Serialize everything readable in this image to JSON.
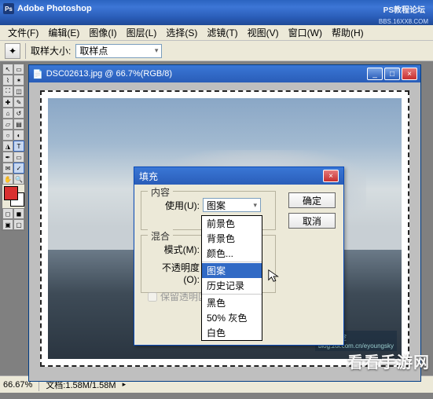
{
  "app": {
    "title": "Adobe Photoshop",
    "tagline1": "PS教程论坛",
    "tagline2": "BBS.16XX8.COM"
  },
  "menu": {
    "items": [
      "文件(F)",
      "编辑(E)",
      "图像(I)",
      "图层(L)",
      "选择(S)",
      "滤镜(T)",
      "视图(V)",
      "窗口(W)",
      "帮助(H)"
    ]
  },
  "options": {
    "sample_label": "取样大小:",
    "sample_value": "取样点"
  },
  "document": {
    "title": "DSC02613.jpg @ 66.7%(RGB/8)",
    "watermark_line1": "样的天空",
    "watermark_line2": "blog.zol.com.cn/eyoungsky"
  },
  "dialog": {
    "title": "填充",
    "content_legend": "内容",
    "use_label": "使用(U):",
    "use_value": "图案",
    "blend_legend": "混合",
    "mode_label": "模式(M):",
    "mode_value": "",
    "opacity_label": "不透明度(O):",
    "opacity_value": "",
    "pct": "%",
    "preserve_label": "保留透明区",
    "ok": "确定",
    "cancel": "取消"
  },
  "dropdown": {
    "items": [
      "前景色",
      "背景色",
      "颜色...",
      "图案",
      "历史记录",
      "黑色",
      "50% 灰色",
      "白色"
    ],
    "selected": "图案"
  },
  "status": {
    "zoom": "66.67%",
    "docsize": "文档:1.58M/1.58M"
  },
  "site_watermark": "看看手游网"
}
